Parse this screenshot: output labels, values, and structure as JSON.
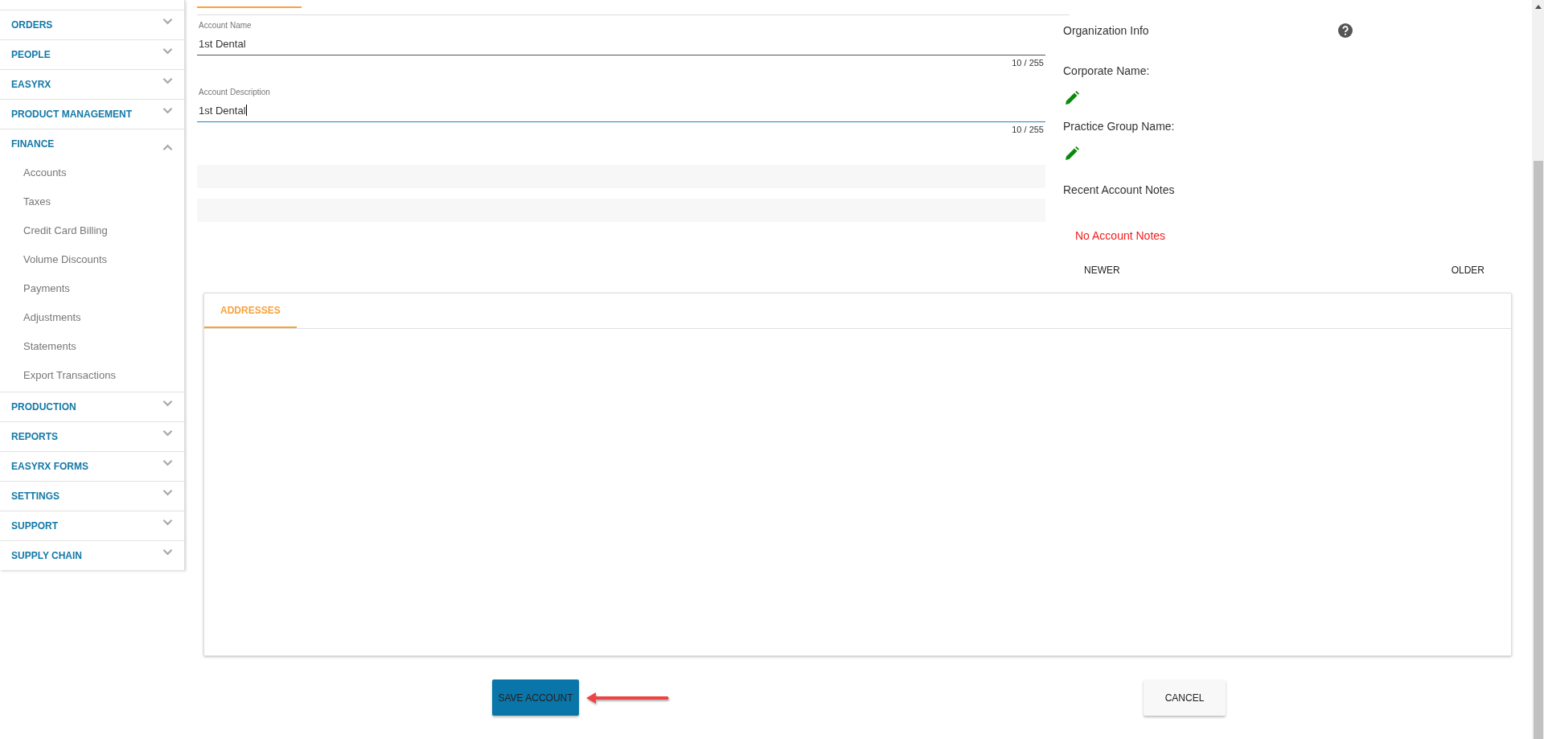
{
  "sidebar": {
    "items": [
      {
        "label": "ORDERS",
        "expanded": false
      },
      {
        "label": "PEOPLE",
        "expanded": false
      },
      {
        "label": "EASYRX",
        "expanded": false
      },
      {
        "label": "PRODUCT MANAGEMENT",
        "expanded": false
      },
      {
        "label": "FINANCE",
        "expanded": true,
        "children": [
          {
            "label": "Accounts"
          },
          {
            "label": "Taxes"
          },
          {
            "label": "Credit Card Billing"
          },
          {
            "label": "Volume Discounts"
          },
          {
            "label": "Payments"
          },
          {
            "label": "Adjustments"
          },
          {
            "label": "Statements"
          },
          {
            "label": "Export Transactions"
          }
        ]
      },
      {
        "label": "PRODUCTION",
        "expanded": false
      },
      {
        "label": "REPORTS",
        "expanded": false
      },
      {
        "label": "EASYRX FORMS",
        "expanded": false
      },
      {
        "label": "SETTINGS",
        "expanded": false
      },
      {
        "label": "SUPPORT",
        "expanded": false
      },
      {
        "label": "SUPPLY CHAIN",
        "expanded": false
      }
    ]
  },
  "form": {
    "fields": [
      {
        "label": "Account Name",
        "value": "1st Dental",
        "counter": "10 / 255",
        "focused": false
      },
      {
        "label": "Account Description",
        "value": "1st Dental",
        "counter": "10 / 255",
        "focused": true
      }
    ]
  },
  "organization": {
    "title": "Organization Info",
    "corporate_name_label": "Corporate Name:",
    "practice_group_label": "Practice Group Name:"
  },
  "notes": {
    "title": "Recent Account Notes",
    "empty_message": "No Account Notes",
    "newer": "NEWER",
    "older": "OLDER"
  },
  "addresses": {
    "tabs": [
      {
        "label": "ADDRESSES",
        "selected": true
      }
    ]
  },
  "buttons": [
    {
      "label": "SAVE ACCOUNT",
      "kind": "primary"
    },
    {
      "label": "CANCEL",
      "kind": "default"
    }
  ]
}
